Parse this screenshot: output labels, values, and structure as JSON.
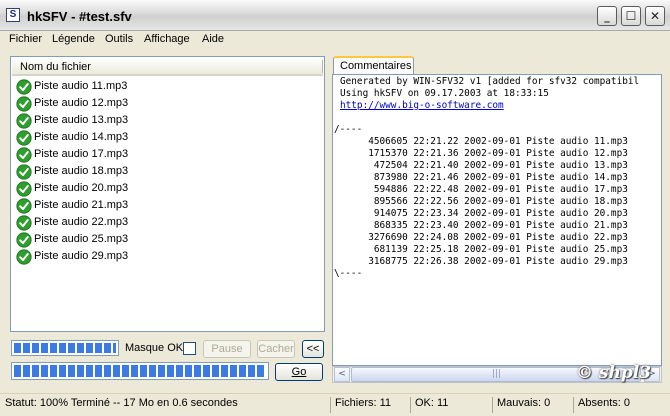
{
  "window": {
    "title": "hkSFV - #test.sfv",
    "app_icon_letter": "S"
  },
  "menu": {
    "fichier": "Fichier",
    "legende": "Légende",
    "outils": "Outils",
    "affichage": "Affichage",
    "aide": "Aide"
  },
  "filelist": {
    "header": "Nom du fichier",
    "files": [
      "Piste audio 11.mp3",
      "Piste audio 12.mp3",
      "Piste audio 13.mp3",
      "Piste audio 14.mp3",
      "Piste audio 17.mp3",
      "Piste audio 18.mp3",
      "Piste audio 20.mp3",
      "Piste audio 21.mp3",
      "Piste audio 22.mp3",
      "Piste audio 25.mp3",
      "Piste audio 29.mp3"
    ],
    "status_icon": "check-circle-icon",
    "status_color": "#2E9E2E"
  },
  "tab": {
    "label": "Commentaires"
  },
  "comments": {
    "line1": "Generated by WIN-SFV32 v1 [added for sfv32 compatibil",
    "line2": "Using hkSFV on 09.17.2003 at 18:33:15",
    "link": "http://www.big-o-software.com",
    "open": "/----",
    "close": "\\----",
    "entries": [
      "     4506605 22:21.22 2002-09-01 Piste audio 11.mp3",
      "     1715370 22:21.36 2002-09-01 Piste audio 12.mp3",
      "      472504 22:21.40 2002-09-01 Piste audio 13.mp3",
      "      873980 22:21.46 2002-09-01 Piste audio 14.mp3",
      "      594886 22:22.48 2002-09-01 Piste audio 17.mp3",
      "      895566 22:22.56 2002-09-01 Piste audio 18.mp3",
      "      914075 22:23.34 2002-09-01 Piste audio 20.mp3",
      "      868335 22:23.40 2002-09-01 Piste audio 21.mp3",
      "     3276690 22:24.08 2002-09-01 Piste audio 22.mp3",
      "      681139 22:25.18 2002-09-01 Piste audio 25.mp3",
      "     3168775 22:26.38 2002-09-01 Piste audio 29.mp3"
    ]
  },
  "controls": {
    "masque_label": "Masque OK",
    "pause": "Pause",
    "cacher": "Cacher",
    "collapse": "<<",
    "go": "Go",
    "progress_file": 1.0,
    "progress_total": 1.0
  },
  "scrollbar": {
    "left": "<",
    "right": ">",
    "grip": "|||"
  },
  "status": {
    "statut": "Statut: 100% Terminé -- 17 Mo en 0.6 secondes",
    "fichiers": "Fichiers: 11",
    "ok": "OK: 11",
    "mauvais": "Mauvais: 0",
    "absents": "Absents: 0"
  },
  "watermark": "© shpl3",
  "colors": {
    "accent": "#3C7AE4",
    "tab_highlight": "#FFC83C",
    "link": "#0000CC"
  }
}
